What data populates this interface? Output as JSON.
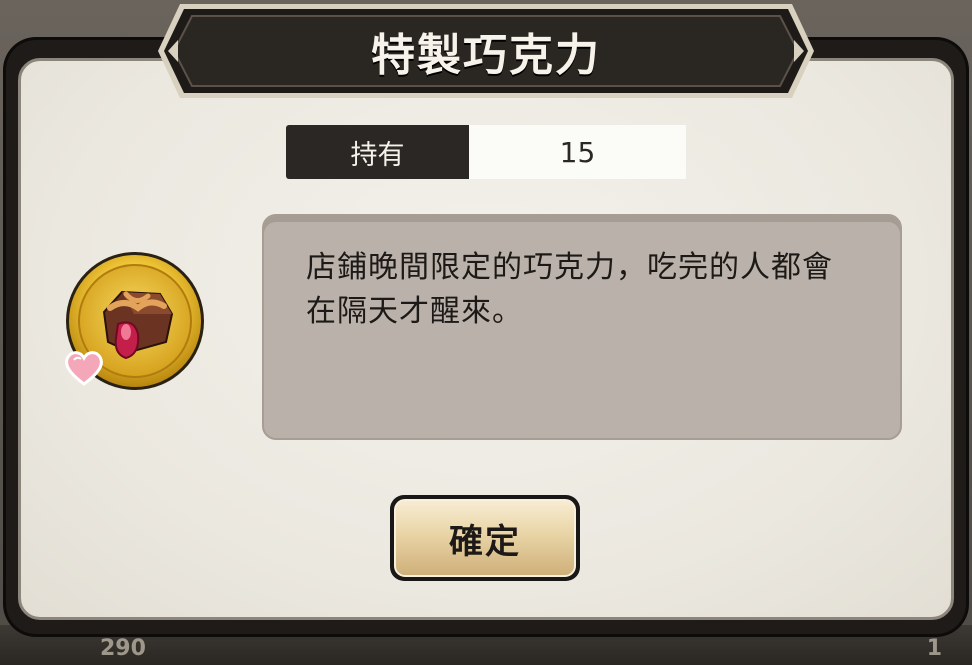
{
  "dialog": {
    "title": "特製巧克力",
    "owned_label": "持有",
    "owned_value": "15",
    "description": "店鋪晚間限定的巧克力，吃完的人都會在隔天才醒來。",
    "confirm_label": "確定"
  },
  "background": {
    "left_count": "290",
    "right_count": "1"
  },
  "icons": {
    "item": "chocolate-item-icon",
    "badge": "heart-icon"
  },
  "colors": {
    "frame": "#1e1b18",
    "panel": "#ebe8e0",
    "desc_box": "#bab2aa",
    "button_gold": "#e9d4a6",
    "medal_gold": "#e8b820"
  }
}
